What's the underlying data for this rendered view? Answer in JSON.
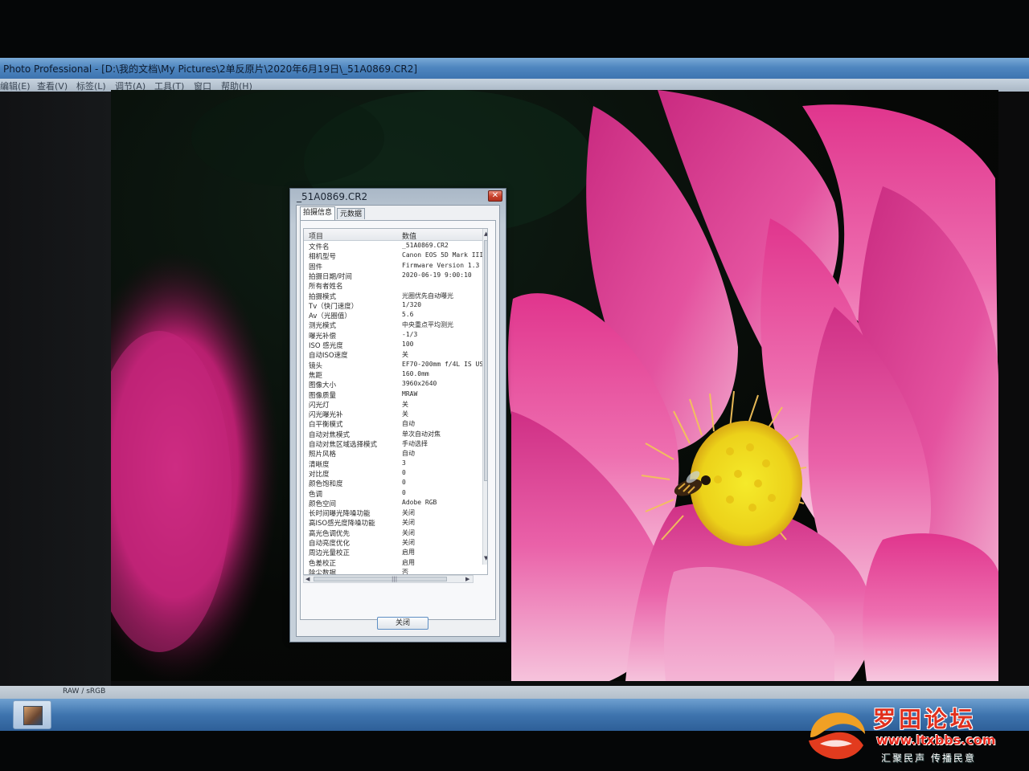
{
  "window": {
    "title": "Photo Professional - [D:\\我的文档\\My Pictures\\2单反原片\\2020年6月19日\\_51A0869.CR2]"
  },
  "menu": [
    {
      "label": "编辑(E)"
    },
    {
      "label": "查看(V)"
    },
    {
      "label": "标签(L)"
    },
    {
      "label": "调节(A)"
    },
    {
      "label": "工具(T)"
    },
    {
      "label": "窗口"
    },
    {
      "label": "帮助(H)"
    }
  ],
  "status": {
    "text": "RAW / sRGB"
  },
  "dialog": {
    "title": "_51A0869.CR2",
    "close_glyph": "✕",
    "tabs": [
      {
        "label": "拍摄信息",
        "active": true
      },
      {
        "label": "元数据",
        "active": false
      }
    ],
    "columns": {
      "key": "项目",
      "value": "数值"
    },
    "rows": [
      {
        "k": "文件名",
        "v": "_51A0869.CR2"
      },
      {
        "k": "相机型号",
        "v": "Canon EOS 5D Mark III"
      },
      {
        "k": "固件",
        "v": "Firmware Version 1.3"
      },
      {
        "k": "拍摄日期/时间",
        "v": "2020-06-19 9:00:10"
      },
      {
        "k": "所有者姓名",
        "v": ""
      },
      {
        "k": "拍摄模式",
        "v": "光圈优先自动曝光"
      },
      {
        "k": "Tv（快门速度）",
        "v": "1/320"
      },
      {
        "k": "Av（光圈值）",
        "v": "5.6"
      },
      {
        "k": "测光模式",
        "v": "中央重点平均测光"
      },
      {
        "k": "曝光补偿",
        "v": "-1/3"
      },
      {
        "k": "ISO 感光度",
        "v": "100"
      },
      {
        "k": "自动ISO速度",
        "v": "关"
      },
      {
        "k": "镜头",
        "v": "EF70-200mm f/4L IS USM"
      },
      {
        "k": "焦距",
        "v": "160.0mm"
      },
      {
        "k": "图像大小",
        "v": "3960x2640"
      },
      {
        "k": "图像质量",
        "v": "MRAW"
      },
      {
        "k": "闪光灯",
        "v": "关"
      },
      {
        "k": "闪光曝光补",
        "v": "关"
      },
      {
        "k": "白平衡模式",
        "v": "自动"
      },
      {
        "k": "自动对焦模式",
        "v": "单次自动对焦"
      },
      {
        "k": "自动对焦区域选择模式",
        "v": "手动选择"
      },
      {
        "k": "照片风格",
        "v": "自动"
      },
      {
        "k": "清晰度",
        "v": "3"
      },
      {
        "k": "对比度",
        "v": "0"
      },
      {
        "k": "颜色饱和度",
        "v": "0"
      },
      {
        "k": "色调",
        "v": "0"
      },
      {
        "k": "颜色空间",
        "v": "Adobe RGB"
      },
      {
        "k": "长时间曝光降噪功能",
        "v": "关闭"
      },
      {
        "k": "高ISO感光度降噪功能",
        "v": "关闭"
      },
      {
        "k": "高光色调优先",
        "v": "关闭"
      },
      {
        "k": "自动亮度优化",
        "v": "关闭"
      },
      {
        "k": "周边光量校正",
        "v": "启用"
      },
      {
        "k": "色差校正",
        "v": "启用"
      },
      {
        "k": "除尘数据",
        "v": "否"
      }
    ],
    "hscroll_grip": "|||",
    "close_button": "关闭"
  },
  "watermark": {
    "title": "罗田论坛",
    "url": "www.ltxbbs.com",
    "slogan": "汇聚民声 传播民意"
  },
  "colors": {
    "titlebar": "#4f86c0",
    "lotus_pink": "#e6459a",
    "stamen_yellow": "#f2e21e",
    "watermark_red": "#e0301e"
  }
}
